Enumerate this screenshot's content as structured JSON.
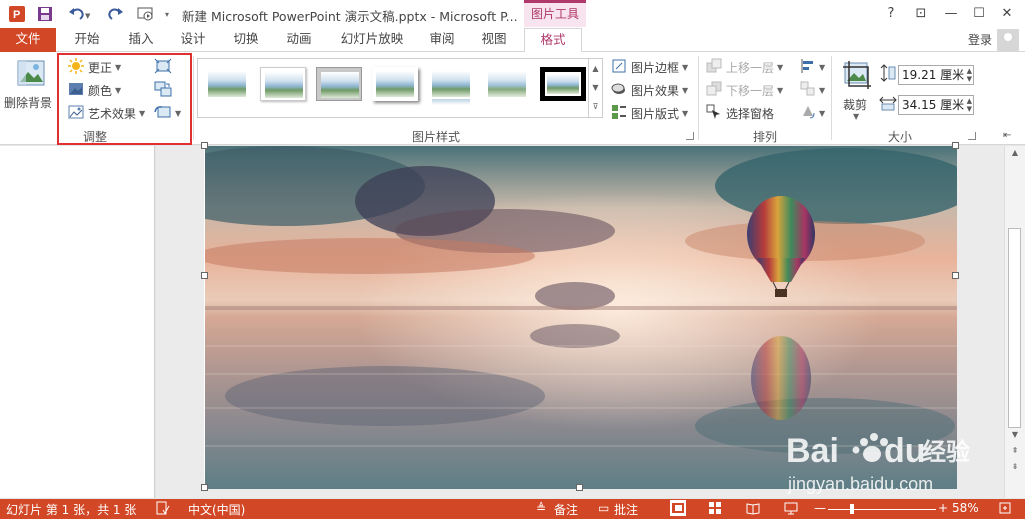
{
  "titlebar": {
    "document_title": "新建 Microsoft PowerPoint 演示文稿.pptx - Microsoft P...",
    "context_tab": "图片工具",
    "help": "?",
    "ribbon_options": "⊡",
    "minimize": "—",
    "restore": "☐",
    "close": "✕",
    "quick_access": [
      "ppt-logo-icon",
      "save-icon",
      "undo-icon",
      "redo-icon",
      "start-presentation-icon",
      "customize-qat-icon"
    ]
  },
  "tabs": {
    "file": "文件",
    "items": [
      "开始",
      "插入",
      "设计",
      "切换",
      "动画",
      "幻灯片放映",
      "审阅",
      "视图"
    ],
    "format": "格式",
    "login": "登录"
  },
  "ribbon": {
    "remove_background": "删除背景",
    "adjust": {
      "corrections": "更正",
      "color": "颜色",
      "artistic_effects": "艺术效果",
      "label": "调整"
    },
    "picture_styles": {
      "label": "图片样式",
      "border": "图片边框",
      "effects": "图片效果",
      "layout": "图片版式"
    },
    "arrange": {
      "label": "排列",
      "bring_forward": "上移一层",
      "send_backward": "下移一层",
      "selection_pane": "选择窗格"
    },
    "size": {
      "label": "大小",
      "crop": "裁剪",
      "height": "19.21 厘米",
      "width": "34.15 厘米"
    }
  },
  "statusbar": {
    "slide_info": "幻灯片 第 1 张，共 1 张",
    "language": "中文(中国)",
    "notes": "备注",
    "comments": "批注",
    "zoom": "58%",
    "zoom_minus": "—",
    "zoom_plus": "+"
  },
  "watermark": {
    "brand": "Bai",
    "brand2": "du",
    "cn": "经验",
    "url": "jingyan.baidu.com"
  },
  "colors": {
    "accent": "#d24726",
    "format_tab": "#b0396b",
    "highlight": "#e03030"
  }
}
